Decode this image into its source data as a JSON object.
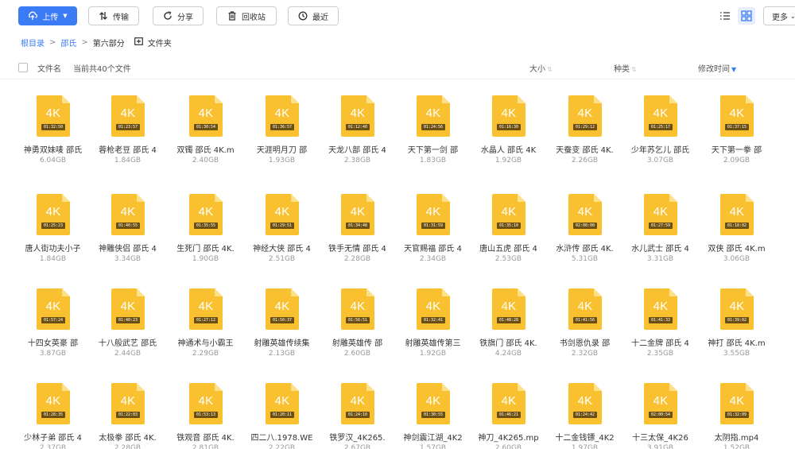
{
  "toolbar": {
    "upload": "上传",
    "transfer": "传输",
    "share": "分享",
    "recycle": "回收站",
    "recent": "最近",
    "more": "更多"
  },
  "breadcrumb": {
    "root": "根目录",
    "level1": "邵氏",
    "level2": "第六部分",
    "new_folder": "文件夹"
  },
  "header": {
    "name": "文件名",
    "count": "当前共40个文件",
    "size": "大小",
    "type": "种类",
    "modified": "修改时间"
  },
  "colors": {
    "accent": "#3b7cf4",
    "thumb": "#f9c12f"
  },
  "files": [
    {
      "name": "神勇双妹唛 邵氏",
      "size": "6.04GB",
      "duration": "01:32:50",
      "badge": "4K"
    },
    {
      "name": "蓉枪老豆 邵氏 4",
      "size": "1.84GB",
      "duration": "01:23:57",
      "badge": "4K"
    },
    {
      "name": "双镯 邵氏 4K.m",
      "size": "2.40GB",
      "duration": "01:30:54",
      "badge": "4K"
    },
    {
      "name": "天涯明月刀 邵",
      "size": "1.93GB",
      "duration": "01:36:57",
      "badge": "4K"
    },
    {
      "name": "天龙八部 邵氏 4",
      "size": "2.38GB",
      "duration": "01:12:40",
      "badge": "4K"
    },
    {
      "name": "天下第一剑 邵",
      "size": "1.83GB",
      "duration": "01:24:56",
      "badge": "4K"
    },
    {
      "name": "水晶人 邵氏 4K",
      "size": "1.92GB",
      "duration": "01:16:30",
      "badge": "4K"
    },
    {
      "name": "天蚕变 邵氏 4K.",
      "size": "2.26GB",
      "duration": "01:29:12",
      "badge": "4K"
    },
    {
      "name": "少年苏乞儿 邵氏",
      "size": "3.07GB",
      "duration": "01:25:17",
      "badge": "4K"
    },
    {
      "name": "天下第一拳 邵",
      "size": "2.09GB",
      "duration": "01:37:15",
      "badge": "4K"
    },
    {
      "name": "唐人街功夫小子",
      "size": "1.84GB",
      "duration": "01:25:23",
      "badge": "4K"
    },
    {
      "name": "神雕侠侣 邵氏 4",
      "size": "3.34GB",
      "duration": "01:40:55",
      "badge": "4K"
    },
    {
      "name": "生死门 邵氏 4K.",
      "size": "1.90GB",
      "duration": "01:35:55",
      "badge": "4K"
    },
    {
      "name": "神经大侠 邵氏 4",
      "size": "2.51GB",
      "duration": "01:29:51",
      "badge": "4K"
    },
    {
      "name": "铁手无情 邵氏 4",
      "size": "2.28GB",
      "duration": "01:34:48",
      "badge": "4K"
    },
    {
      "name": "天官赐福 邵氏 4",
      "size": "2.34GB",
      "duration": "01:31:59",
      "badge": "4K"
    },
    {
      "name": "唐山五虎 邵氏 4",
      "size": "2.53GB",
      "duration": "01:35:10",
      "badge": "4K"
    },
    {
      "name": "水浒传 邵氏 4K.",
      "size": "5.31GB",
      "duration": "02:00:00",
      "badge": "4K"
    },
    {
      "name": "水儿武士 邵氏 4",
      "size": "3.31GB",
      "duration": "01:27:59",
      "badge": "4K"
    },
    {
      "name": "双侠 邵氏 4K.m",
      "size": "3.06GB",
      "duration": "01:18:02",
      "badge": "4K"
    },
    {
      "name": "十四女英豪 邵",
      "size": "3.87GB",
      "duration": "01:57:24",
      "badge": "4K"
    },
    {
      "name": "十八般武艺 邵氏",
      "size": "2.44GB",
      "duration": "01:40:23",
      "badge": "4K"
    },
    {
      "name": "神通术与小霸王",
      "size": "2.29GB",
      "duration": "01:27:12",
      "badge": "4K"
    },
    {
      "name": "射雕英雄传续集",
      "size": "2.13GB",
      "duration": "01:50:37",
      "badge": "4K"
    },
    {
      "name": "射雕英雄传 邵",
      "size": "2.60GB",
      "duration": "01:56:51",
      "badge": "4K"
    },
    {
      "name": "射雕英雄传第三",
      "size": "1.92GB",
      "duration": "01:32:41",
      "badge": "4K"
    },
    {
      "name": "铁旗门 邵氏 4K.",
      "size": "4.24GB",
      "duration": "01:48:28",
      "badge": "4K"
    },
    {
      "name": "书剑恩仇录 邵",
      "size": "2.32GB",
      "duration": "01:41:56",
      "badge": "4K"
    },
    {
      "name": "十二金牌 邵氏 4",
      "size": "2.35GB",
      "duration": "01:41:33",
      "badge": "4K"
    },
    {
      "name": "神打 邵氏 4K.m",
      "size": "3.55GB",
      "duration": "01:39:02",
      "badge": "4K"
    },
    {
      "name": "少林子弟 邵氏 4",
      "size": "2.37GB",
      "duration": "01:28:35",
      "badge": "4K"
    },
    {
      "name": "太极拳 邵氏 4K.",
      "size": "2.28GB",
      "duration": "01:22:03",
      "badge": "4K"
    },
    {
      "name": "铁观音 邵氏 4K.",
      "size": "2.81GB",
      "duration": "01:53:13",
      "badge": "4K"
    },
    {
      "name": "四二八.1978.WE",
      "size": "2.22GB",
      "duration": "01:20:11",
      "badge": "4K"
    },
    {
      "name": "铁罗汉_4K265.",
      "size": "2.67GB",
      "duration": "01:24:10",
      "badge": "4K"
    },
    {
      "name": "神剑震江湖_4K2",
      "size": "1.57GB",
      "duration": "01:30:55",
      "badge": "4K"
    },
    {
      "name": "神刀_4K265.mp",
      "size": "2.60GB",
      "duration": "01:46:21",
      "badge": "4K"
    },
    {
      "name": "十二金钱镖_4K2",
      "size": "1.97GB",
      "duration": "01:24:42",
      "badge": "4K"
    },
    {
      "name": "十三太保_4K26",
      "size": "3.91GB",
      "duration": "02:00:54",
      "badge": "4K"
    },
    {
      "name": "太阴指.mp4",
      "size": "1.52GB",
      "duration": "01:32:09",
      "badge": "4K"
    }
  ]
}
